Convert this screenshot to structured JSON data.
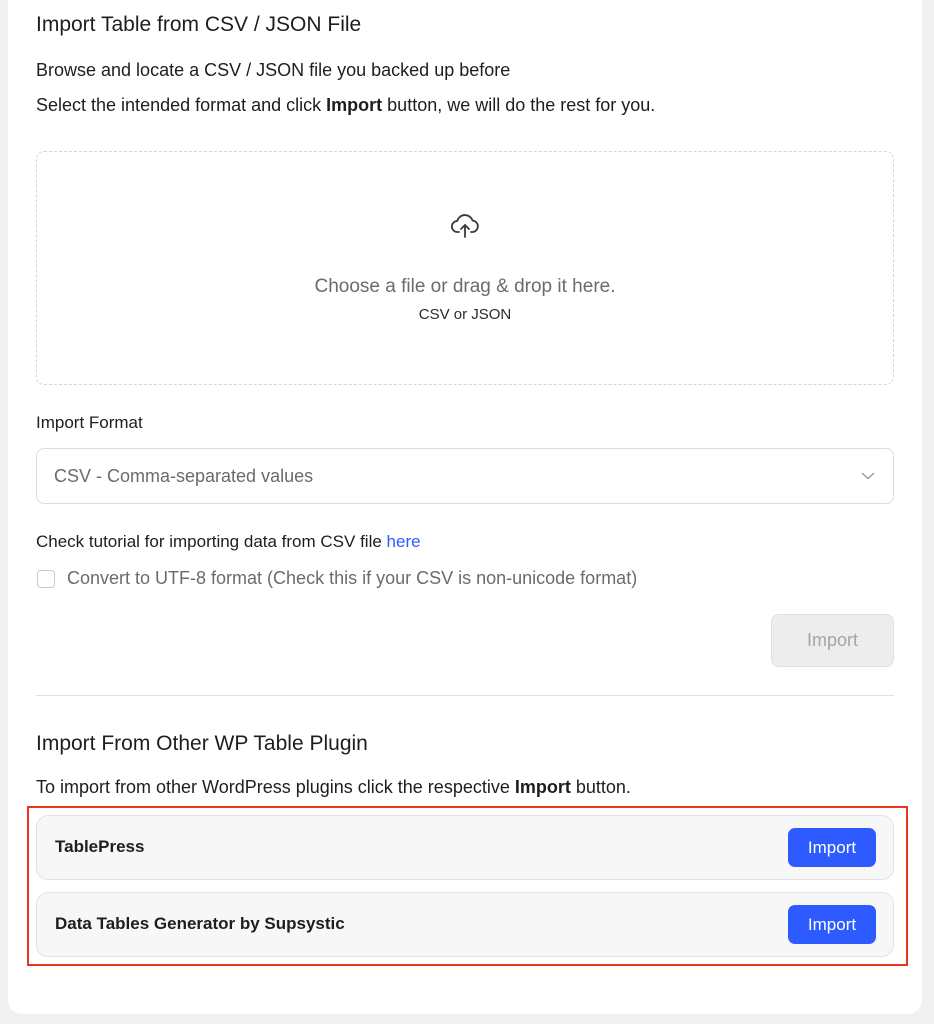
{
  "csv_import": {
    "title": "Import Table from CSV / JSON File",
    "description_line1": "Browse and locate a CSV / JSON file you backed up before",
    "description_line2_before": "Select the intended format and click ",
    "description_line2_bold": "Import",
    "description_line2_after": " button, we will do the rest for you.",
    "dropzone": {
      "icon": "cloud-upload-icon",
      "main_text": "Choose a file or drag & drop it here.",
      "sub_text": "CSV or JSON"
    },
    "format_label": "Import Format",
    "format_selected": "CSV - Comma-separated values",
    "tutorial_text": "Check tutorial for importing data from CSV file ",
    "tutorial_link": "here",
    "utf8_label": "Convert to UTF-8 format (Check this if your CSV is non-unicode format)",
    "import_button": "Import"
  },
  "plugin_import": {
    "title": "Import From Other WP Table Plugin",
    "description_before": "To import from other WordPress plugins click the respective ",
    "description_bold": "Import",
    "description_after": " button.",
    "plugins": [
      {
        "name": "TablePress",
        "button": "Import"
      },
      {
        "name": "Data Tables Generator by Supsystic",
        "button": "Import"
      }
    ]
  },
  "colors": {
    "primary": "#2e5bff",
    "highlight_border": "#e8361e",
    "link": "#2e5bff"
  }
}
